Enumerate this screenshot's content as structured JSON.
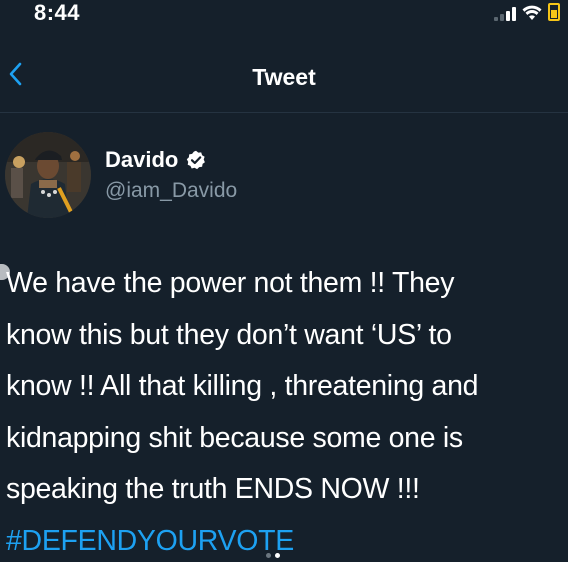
{
  "status_bar": {
    "time": "8:44"
  },
  "nav": {
    "title": "Tweet",
    "back_icon": "chevron-left-icon"
  },
  "tweet": {
    "author": {
      "display_name": "Davido",
      "handle": "@iam_Davido",
      "verified": true
    },
    "text_lines": [
      "We have the power not them !! They",
      "know this but they don’t want ‘US’ to",
      "know !! All that killing , threatening and",
      "kidnapping shit because some one is",
      "speaking the truth ENDS NOW !!!"
    ],
    "hashtag": "#DEFENDYOURVOTE"
  },
  "pager": {
    "count": 2,
    "active_index": 1
  },
  "colors": {
    "background": "#15202b",
    "accent": "#1da1f2",
    "secondary_text": "#8899a6",
    "battery": "#f5c518"
  }
}
